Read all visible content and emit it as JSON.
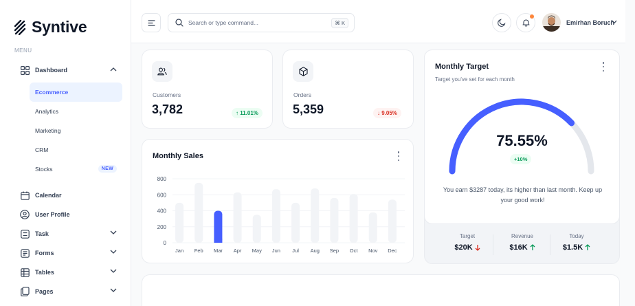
{
  "brand": {
    "name": "Syntive"
  },
  "sidebar": {
    "menu_heading": "MENU",
    "dashboard": {
      "label": "Dashboard",
      "icon": "grid-icon"
    },
    "dashboard_sub": [
      {
        "label": "Ecommerce",
        "active": true
      },
      {
        "label": "Analytics"
      },
      {
        "label": "Marketing"
      },
      {
        "label": "CRM"
      },
      {
        "label": "Stocks",
        "badge": "NEW"
      }
    ],
    "items": [
      {
        "label": "Calendar",
        "icon": "calendar-icon"
      },
      {
        "label": "User Profile",
        "icon": "user-circle-icon"
      },
      {
        "label": "Task",
        "icon": "task-icon"
      },
      {
        "label": "Forms",
        "icon": "forms-icon"
      },
      {
        "label": "Tables",
        "icon": "table-icon"
      },
      {
        "label": "Pages",
        "icon": "pages-icon"
      }
    ]
  },
  "header": {
    "search_placeholder": "Search or type command...",
    "shortcut": "⌘ K",
    "user_name": "Emirhan Boruch"
  },
  "metrics": {
    "customers": {
      "label": "Customers",
      "value": "3,782",
      "change": "↑ 11.01%",
      "trend": "up"
    },
    "orders": {
      "label": "Orders",
      "value": "5,359",
      "change": "↓ 9.05%",
      "trend": "down"
    }
  },
  "monthly_sales": {
    "title": "Monthly Sales"
  },
  "chart_data": {
    "type": "bar",
    "title": "Monthly Sales",
    "categories": [
      "Jan",
      "Feb",
      "Mar",
      "Apr",
      "May",
      "Jun",
      "Jul",
      "Aug",
      "Sep",
      "Oct",
      "Nov",
      "Dec"
    ],
    "values": [
      500,
      750,
      400,
      630,
      350,
      670,
      500,
      680,
      560,
      610,
      380,
      540
    ],
    "highlight_index": 2,
    "yticks": [
      0,
      200,
      400,
      600,
      800
    ],
    "ylim": [
      0,
      800
    ],
    "grid": true,
    "colors": {
      "bar": "#f2f4f7",
      "highlight": "#465fff"
    }
  },
  "monthly_target": {
    "title": "Monthly Target",
    "subtitle": "Target you've set for each month",
    "percent": "75.55%",
    "percent_value": 75.55,
    "change": "+10%",
    "message": "You earn $3287 today, its higher than last month. Keep up your good work!",
    "stats": [
      {
        "label": "Target",
        "value": "$20K",
        "trend": "down"
      },
      {
        "label": "Revenue",
        "value": "$16K",
        "trend": "up"
      },
      {
        "label": "Today",
        "value": "$1.5K",
        "trend": "up"
      }
    ]
  },
  "colors": {
    "accent": "#465fff",
    "success": "#039855",
    "danger": "#d92d20"
  }
}
